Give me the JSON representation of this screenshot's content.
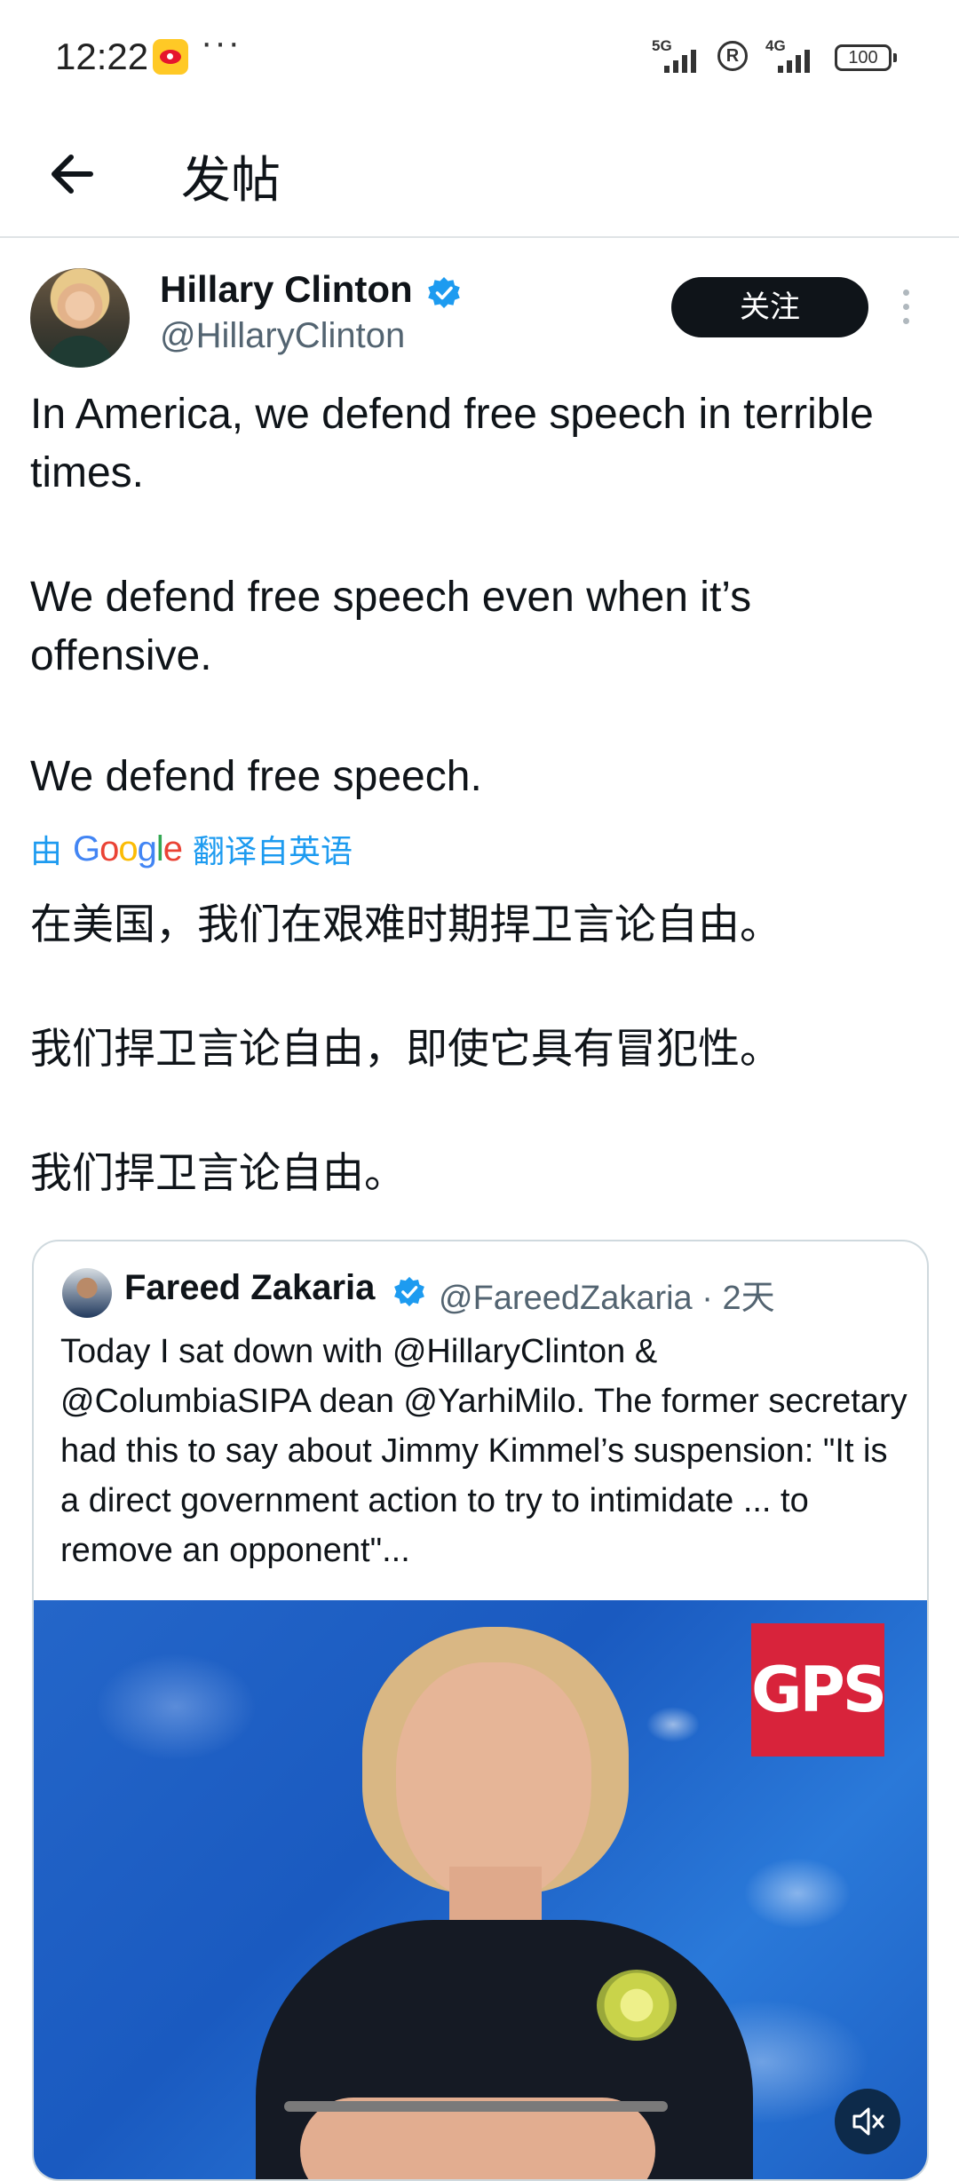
{
  "status_bar": {
    "time": "12:22",
    "more": "···",
    "signal1_label": "5G",
    "signal2_label": "4G",
    "battery": "100",
    "icons": [
      "weibo-icon",
      "signal-5g-icon",
      "registered-icon",
      "signal-4g-icon",
      "battery-icon"
    ]
  },
  "header": {
    "title": "发帖",
    "back_icon": "arrow-left-icon"
  },
  "tweet": {
    "author_name": "Hillary Clinton",
    "author_handle": "@HillaryClinton",
    "follow_label": "关注",
    "text_en": [
      "In America, we defend free speech in terrible times.",
      "We defend free speech even when it’s offensive.",
      "We defend free speech."
    ],
    "translation": {
      "prefix": "由",
      "brand": "Google",
      "suffix": "翻译自英语"
    },
    "text_cn": [
      "在美国，我们在艰难时期捍卫言论自由。",
      "我们捍卫言论自由，即使它具有冒犯性。",
      "我们捍卫言论自由。"
    ]
  },
  "quoted": {
    "author_name": "Fareed Zakaria",
    "handle_time": "@FareedZakaria · 2天",
    "text": "Today I sat down with @HillaryClinton & @ColumbiaSIPA dean @YarhiMilo. The former secretary had this to say about Jimmy Kimmel’s suspension: \"It is a direct government action to try to intimidate ... to remove an opponent\"...",
    "media_badge": "GPS",
    "mute_icon": "speaker-muted-icon"
  },
  "colors": {
    "accent": "#1d9bf0",
    "text": "#0f1419",
    "secondary": "#536471",
    "follow_bg": "#0f1419",
    "gps_red": "#d8233b"
  }
}
